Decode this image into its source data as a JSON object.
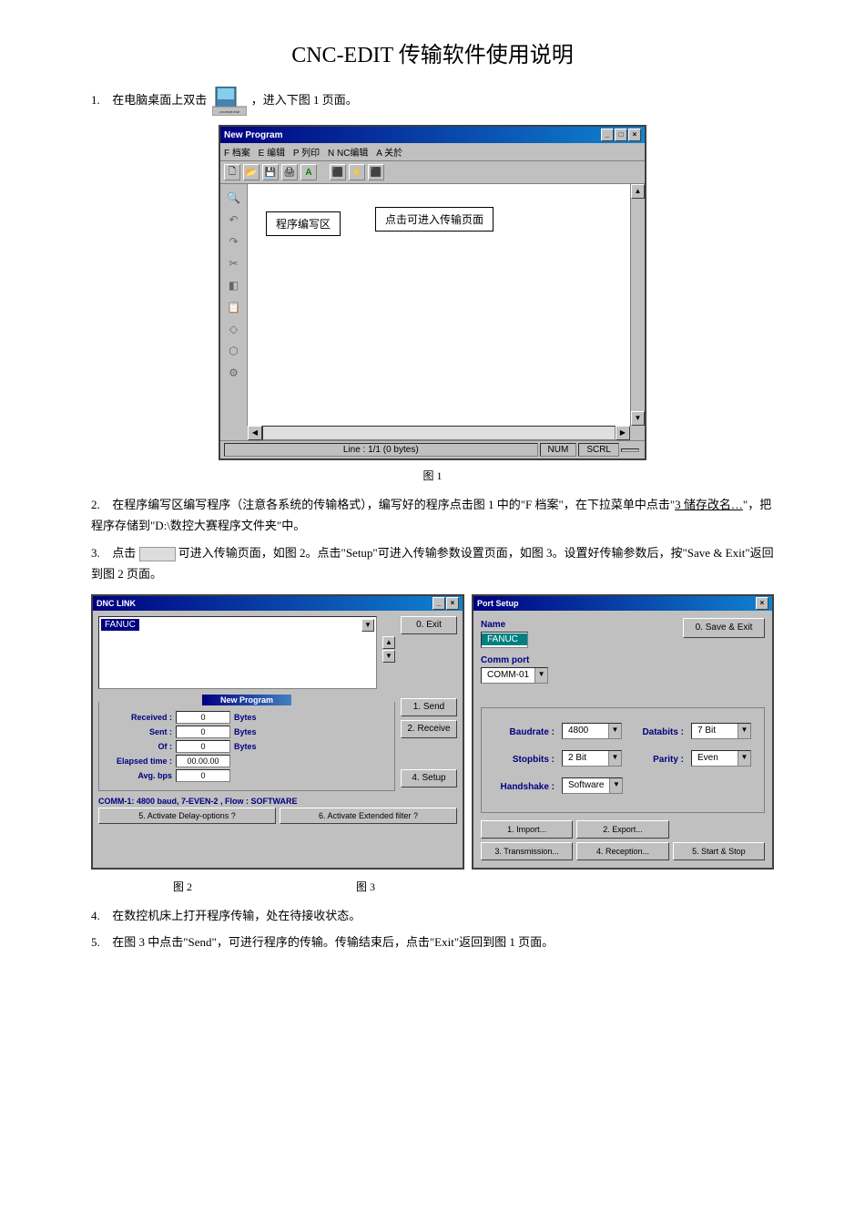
{
  "title": "CNC-EDIT 传输软件使用说明",
  "shortcut_label": "快捷方式 到\nCNCEDIT.EXE",
  "steps": {
    "s1": {
      "num": "1.",
      "text_a": "在电脑桌面上双击",
      "text_b": "，进入下图 1 页面。"
    },
    "s2": {
      "num": "2.",
      "text_a": "在程序编写区编写程序（注意各系统的传输格式），编写好的程序点击图 1 中的\"F 档案\"，在下拉菜单中点击\"",
      "link": "3 储存改名…",
      "text_b": "\"，把程序存储到\"D:\\数控大赛程序文件夹\"中。"
    },
    "s3": {
      "num": "3.",
      "text_a": "点击",
      "text_b": "可进入传输页面，如图 2。点击\"Setup\"可进入传输参数设置页面，如图 3。设置好传输参数后，按\"Save & Exit\"返回到图 2 页面。"
    },
    "s4": {
      "num": "4.",
      "text": "在数控机床上打开程序传输，处在待接收状态。"
    },
    "s5": {
      "num": "5.",
      "text": "在图 3 中点击\"Send\"，可进行程序的传输。传输结束后，点击\"Exit\"返回到图 1 页面。"
    }
  },
  "fig_captions": {
    "fig1": "图 1",
    "fig2": "图 2",
    "fig3": "图 3"
  },
  "window1": {
    "title": "New Program",
    "win_min": "_",
    "win_max": "□",
    "win_close": "×",
    "menu": {
      "file": "F 档案",
      "edit": "E 编辑",
      "print": "P 列印",
      "ncedit": "N NC编辑",
      "about": "A 关於"
    },
    "toolbar": {
      "new": "🗋",
      "open": "📂",
      "save": "💾",
      "print": "🖨",
      "a": "A"
    },
    "sidebar": {
      "find": "🔍",
      "undo": "↶",
      "redo": "↷",
      "cut": "✂",
      "img1": "◧",
      "img2": "📋",
      "dia": "◇",
      "tool1": "⬡",
      "tool2": "⚙"
    },
    "callout_editor": "程序编写区",
    "callout_click": "点击可进入传输页面",
    "status_line": "Line : 1/1 (0 bytes)",
    "status_num": "NUM",
    "status_scrl": "SCRL"
  },
  "window2": {
    "title": "DNC LINK",
    "win_min": "_",
    "win_close": "×",
    "name_selected": "FANUC",
    "btn_exit": "0. Exit",
    "group_title": "New Program",
    "stats": {
      "received": {
        "label": "Received :",
        "value": "0",
        "unit": "Bytes"
      },
      "sent": {
        "label": "Sent :",
        "value": "0",
        "unit": "Bytes"
      },
      "of": {
        "label": "Of :",
        "value": "0",
        "unit": "Bytes"
      },
      "elapsed": {
        "label": "Elapsed time :",
        "value": "00.00.00",
        "unit": ""
      },
      "avg": {
        "label": "Avg. bps",
        "value": "0",
        "unit": ""
      }
    },
    "btn_send": "1. Send",
    "btn_receive": "2. Receive",
    "btn_setup": "4. Setup",
    "comm_info": "COMM-1: 4800 baud, 7-EVEN-2 , Flow : SOFTWARE",
    "btn_delay": "5. Activate Delay-options ?",
    "btn_extfilter": "6. Activate Extended filter ?"
  },
  "window3": {
    "title": "Port Setup",
    "win_close": "×",
    "name_label": "Name",
    "name_value": "FANUC",
    "comm_label": "Comm port",
    "comm_value": "COMM-01",
    "btn_save_exit": "0. Save & Exit",
    "params": {
      "baudrate": {
        "label": "Baudrate :",
        "value": "4800"
      },
      "databits": {
        "label": "Databits :",
        "value": "7 Bit"
      },
      "stopbits": {
        "label": "Stopbits :",
        "value": "2 Bit"
      },
      "parity": {
        "label": "Parity :",
        "value": "Even"
      },
      "handshake": {
        "label": "Handshake :",
        "value": "Software"
      }
    },
    "btn_import": "1. Import...",
    "btn_export": "2. Export...",
    "btn_transmission": "3. Transmission...",
    "btn_reception": "4. Reception...",
    "btn_startstop": "5. Start & Stop"
  }
}
